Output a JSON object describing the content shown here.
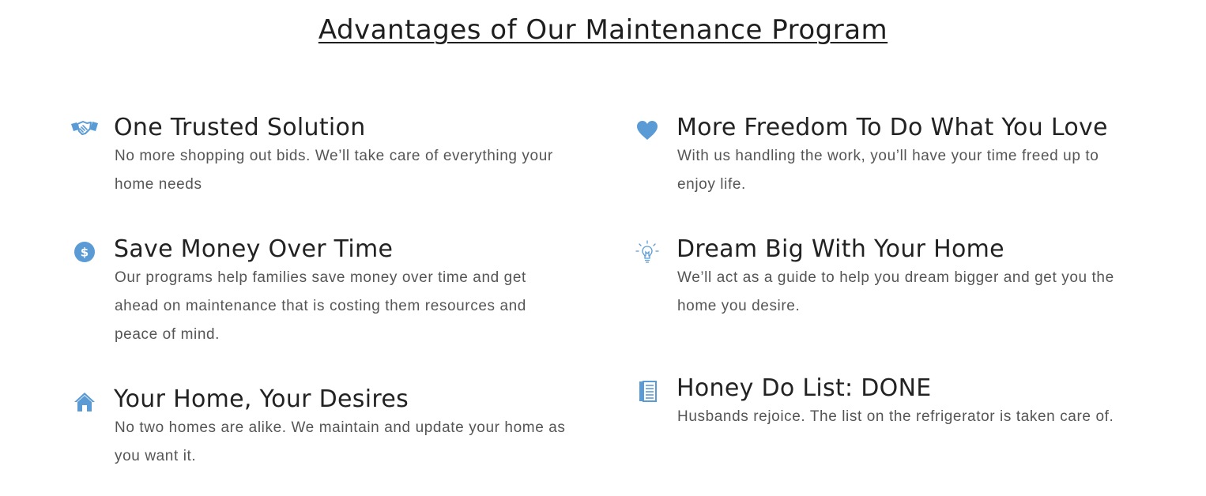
{
  "title": "Advantages of Our Maintenance Program",
  "accent_color": "#5b9bd5",
  "features": [
    {
      "icon": "handshake-icon",
      "heading": "One Trusted Solution",
      "text": "No more shopping out bids. We’ll take care of everything your home needs"
    },
    {
      "icon": "dollar-circle-icon",
      "heading": "Save Money Over Time",
      "text": "Our programs help families save money over time and get ahead on maintenance that is costing them resources and peace of mind."
    },
    {
      "icon": "home-icon",
      "heading": "Your Home, Your Desires",
      "text": "No two homes are alike. We maintain and update your home as you want it."
    },
    {
      "icon": "heart-icon",
      "heading": "More Freedom To Do What You Love",
      "text": "With us handling the work, you’ll have your time freed up to enjoy life."
    },
    {
      "icon": "lightbulb-icon",
      "heading": "Dream Big With Your Home",
      "text": "We’ll act as a guide to help you dream bigger and get you the home you desire."
    },
    {
      "icon": "notepad-icon",
      "heading": "Honey Do List: DONE",
      "text": "Husbands rejoice. The list on the refrigerator is taken care of."
    }
  ]
}
